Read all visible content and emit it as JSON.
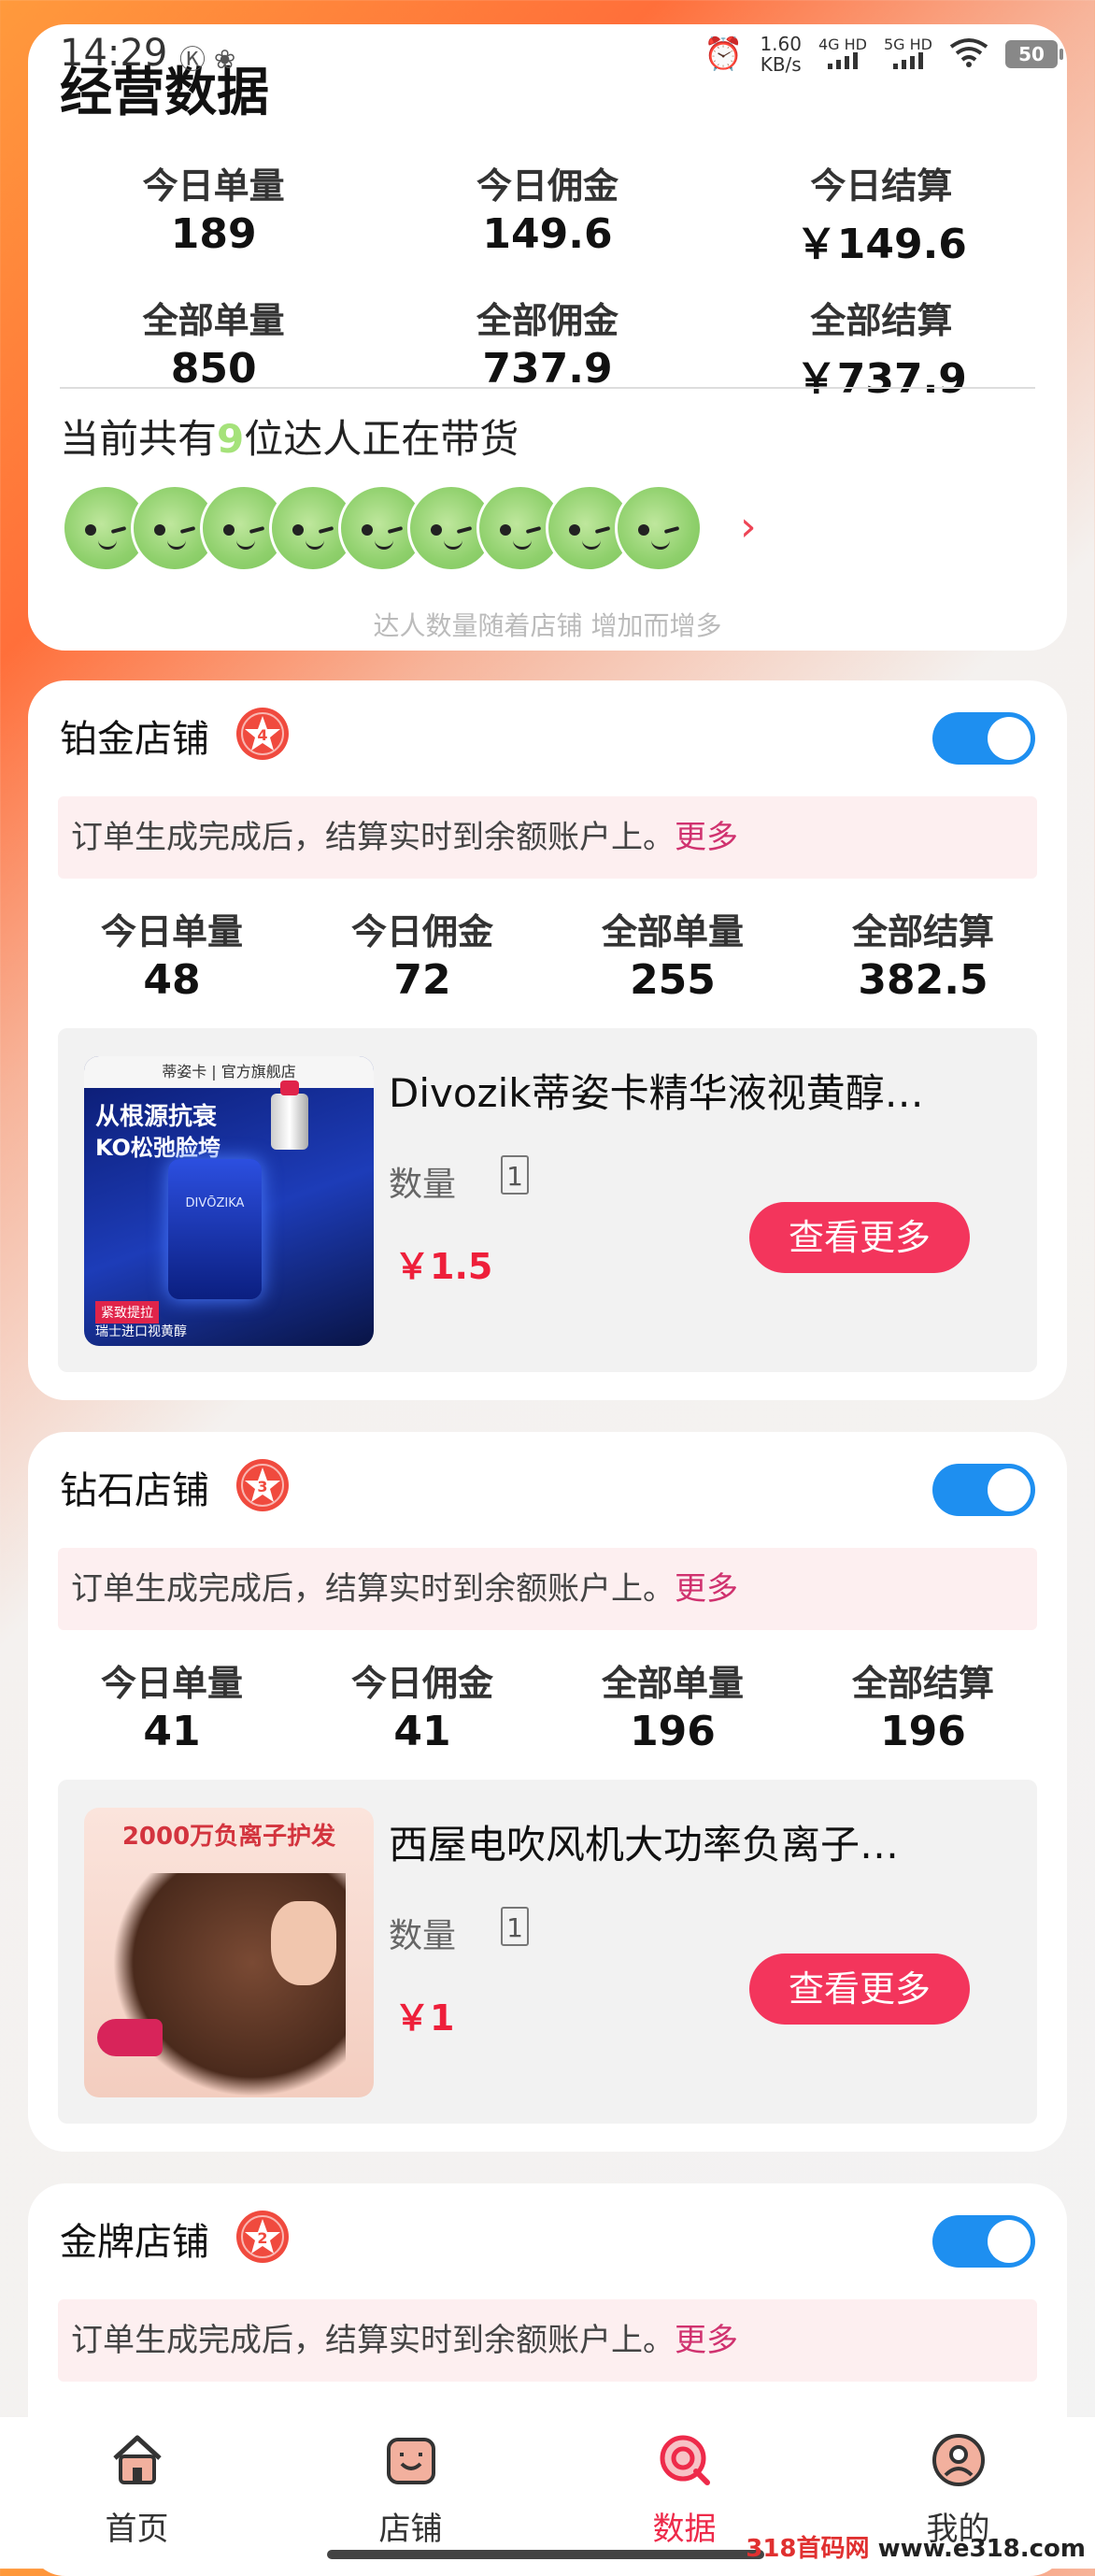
{
  "status_bar": {
    "time": "14:29",
    "indicators": "Ⓚ ❀",
    "net_speed_value": "1.60",
    "net_speed_unit": "KB/s",
    "signal_1": "4G HD",
    "signal_2": "5G HD",
    "battery": "50"
  },
  "overview": {
    "title": "经营数据",
    "stats_row1": [
      {
        "label": "今日单量",
        "value": "189"
      },
      {
        "label": "今日佣金",
        "value": "149.6"
      },
      {
        "label": "今日结算",
        "value": "￥149.6"
      }
    ],
    "stats_row2": [
      {
        "label": "全部单量",
        "value": "850"
      },
      {
        "label": "全部佣金",
        "value": "737.9"
      },
      {
        "label": "全部结算",
        "value": "￥737.9"
      }
    ],
    "creator_prefix": "当前共有",
    "creator_count": "9",
    "creator_suffix": "位达人正在带货",
    "creator_note": "达人数量随着店铺 增加而增多"
  },
  "shops": [
    {
      "name": "铂金店铺",
      "rank": "4",
      "enabled": true,
      "notice": "订单生成完成后，结算实时到余额账户上。",
      "notice_more": "更多",
      "stats": [
        {
          "label": "今日单量",
          "value": "48"
        },
        {
          "label": "今日佣金",
          "value": "72"
        },
        {
          "label": "全部单量",
          "value": "255"
        },
        {
          "label": "全部结算",
          "value": "382.5"
        }
      ],
      "product": {
        "title": "Divozik蒂姿卡精华液视黄醇…",
        "qty_label": "数量",
        "qty": "1",
        "price": "￥1.5",
        "button": "查看更多",
        "thumb_lines": [
          "蒂姿卡 | 官方旗舰店",
          "从根源抗衰",
          "KO松弛脸垮",
          "DIVŌZIKA",
          "紧致提拉",
          "瑞士进口视黄醇"
        ]
      }
    },
    {
      "name": "钻石店铺",
      "rank": "3",
      "enabled": true,
      "notice": "订单生成完成后，结算实时到余额账户上。",
      "notice_more": "更多",
      "stats": [
        {
          "label": "今日单量",
          "value": "41"
        },
        {
          "label": "今日佣金",
          "value": "41"
        },
        {
          "label": "全部单量",
          "value": "196"
        },
        {
          "label": "全部结算",
          "value": "196"
        }
      ],
      "product": {
        "title": "西屋电吹风机大功率负离子…",
        "qty_label": "数量",
        "qty": "1",
        "price": "￥1",
        "button": "查看更多",
        "thumb_lines": [
          "2000万负离子护发"
        ]
      }
    },
    {
      "name": "金牌店铺",
      "rank": "2",
      "enabled": true,
      "notice": "订单生成完成后，结算实时到余额账户上。",
      "notice_more": "更多"
    }
  ],
  "tabbar": [
    {
      "label": "首页",
      "icon": "home-icon",
      "active": false
    },
    {
      "label": "店铺",
      "icon": "store-icon",
      "active": false
    },
    {
      "label": "数据",
      "icon": "data-icon",
      "active": true
    },
    {
      "label": "我的",
      "icon": "profile-icon",
      "active": false
    }
  ],
  "watermark": {
    "brand": "318首码网",
    "url": "www.e318.com"
  },
  "colors": {
    "accent": "#f3355c",
    "toggle": "#1e8ff0",
    "price": "#ee1f3a",
    "creator_count": "#a5e27a"
  }
}
